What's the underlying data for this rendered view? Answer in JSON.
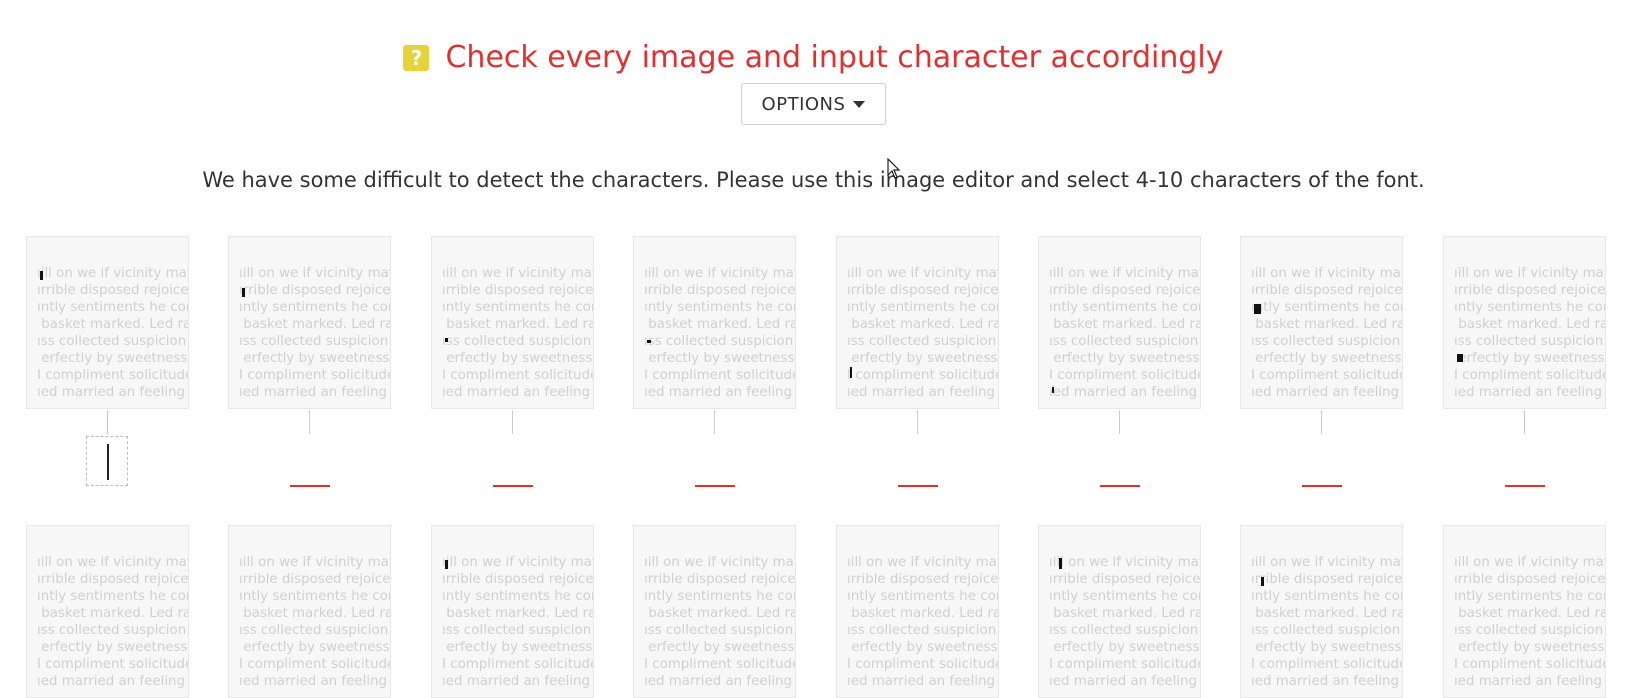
{
  "header": {
    "help_icon_glyph": "?",
    "help_icon_color": "#e6d23a",
    "title": "Check every image and input character accordingly",
    "title_color": "#e03131"
  },
  "options_button": {
    "label": "OPTIONS",
    "icon": "caret-down-icon"
  },
  "instruction": "We have some difficult to detect the characters. Please use this image editor and select 4-10 characters of the font.",
  "sample_text": "ıill on we if vicinity materi\nırrible disposed rejoiced. U\nıntly sentiments he connec\n basket marked. Led raising\nıss collected suspicion exis\n erfectly by sweetness do. \nI compliment solicitude. Di\nıed married an feeling deli",
  "row1_cards": [
    {
      "active": true
    },
    {
      "active": false
    },
    {
      "active": false
    },
    {
      "active": false
    },
    {
      "active": false
    },
    {
      "active": false
    },
    {
      "active": false
    },
    {
      "active": false
    }
  ],
  "row2_cards_count": 8,
  "accent_underline_color": "#e03131"
}
